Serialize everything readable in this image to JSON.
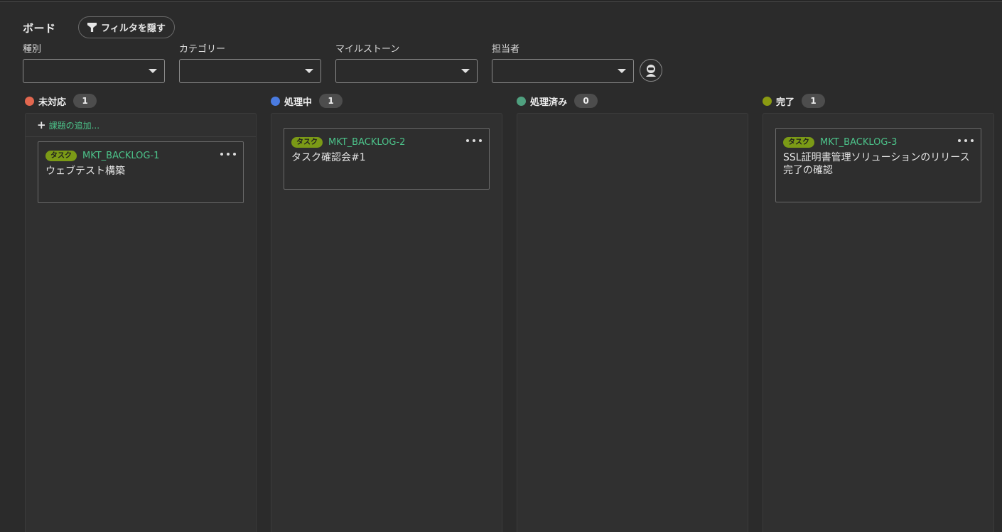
{
  "header": {
    "title": "ボード",
    "filter_toggle_label": "フィルタを隠す"
  },
  "filters": [
    {
      "label": "種別",
      "value": ""
    },
    {
      "label": "カテゴリー",
      "value": ""
    },
    {
      "label": "マイルストーン",
      "value": ""
    },
    {
      "label": "担当者",
      "value": ""
    }
  ],
  "columns": [
    {
      "title": "未対応",
      "count": "1",
      "color": "#e2674f",
      "add_label": "課題の追加...",
      "cards": [
        {
          "type": "タスク",
          "key": "MKT_BACKLOG-1",
          "title": "ウェブテスト構築"
        }
      ]
    },
    {
      "title": "処理中",
      "count": "1",
      "color": "#4a7be0",
      "cards": [
        {
          "type": "タスク",
          "key": "MKT_BACKLOG-2",
          "title": "タスク確認会#1"
        }
      ]
    },
    {
      "title": "処理済み",
      "count": "0",
      "color": "#4fa07f",
      "cards": []
    },
    {
      "title": "完了",
      "count": "1",
      "color": "#8a9a12",
      "cards": [
        {
          "type": "タスク",
          "key": "MKT_BACKLOG-3",
          "title": "SSL証明書管理ソリューションのリリース完了の確認"
        }
      ]
    }
  ],
  "colors": {
    "accent_green": "#4cc38a",
    "badge": "#7b9a16",
    "background": "#2b2b2b"
  }
}
